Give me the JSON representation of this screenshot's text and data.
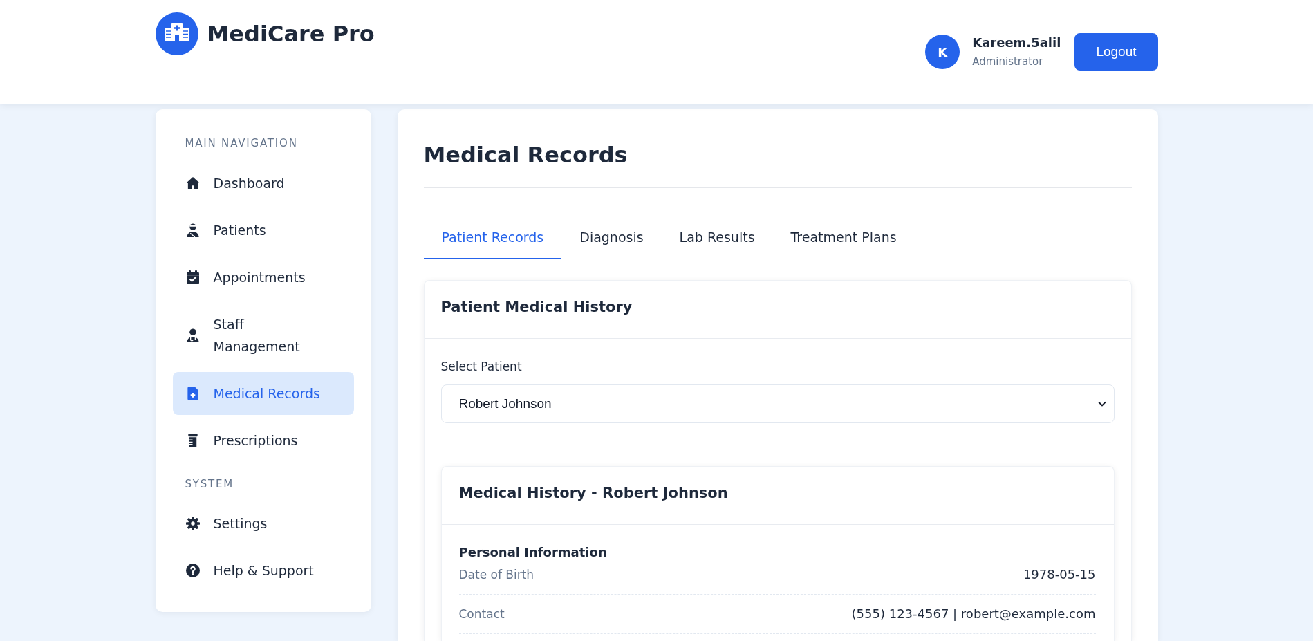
{
  "header": {
    "app_title": "MediCare Pro",
    "user": {
      "initial": "K",
      "name": "Kareem.5alil",
      "role": "Administrator"
    },
    "logout_button": "Logout"
  },
  "sidebar": {
    "sections": [
      {
        "title": "MAIN NAVIGATION",
        "items": [
          {
            "label": "Dashboard",
            "selected": false
          },
          {
            "label": "Patients",
            "selected": false
          },
          {
            "label": "Appointments",
            "selected": false
          },
          {
            "label": "Staff Management",
            "selected": false
          },
          {
            "label": "Medical Records",
            "selected": true
          },
          {
            "label": "Prescriptions",
            "selected": false
          }
        ]
      },
      {
        "title": "SYSTEM",
        "items": [
          {
            "label": "Settings",
            "selected": false
          },
          {
            "label": "Help & Support",
            "selected": false
          }
        ]
      }
    ]
  },
  "main": {
    "title": "Medical Records",
    "tabs": [
      {
        "label": "Patient Records",
        "selected": true
      },
      {
        "label": "Diagnosis",
        "selected": false
      },
      {
        "label": "Lab Results",
        "selected": false
      },
      {
        "label": "Treatment Plans",
        "selected": false
      }
    ],
    "history_card": {
      "title": "Patient Medical History",
      "select_label": "Select Patient",
      "patient_select": {
        "value": "Robert Johnson"
      },
      "record_card": {
        "title": "Medical History - Robert Johnson",
        "sections": [
          {
            "title": "Personal Information",
            "rows": [
              {
                "label": "Date of Birth",
                "value": "1978-05-15"
              },
              {
                "label": "Contact",
                "value": "(555) 123-4567 | robert@example.com"
              }
            ]
          }
        ]
      }
    }
  }
}
